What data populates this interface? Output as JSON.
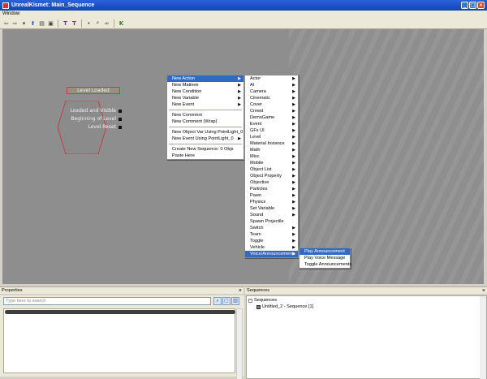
{
  "window": {
    "title": "UnrealKismet: Main_Sequence",
    "buttons": [
      "_",
      "□",
      "×"
    ]
  },
  "menubar": {
    "items": [
      "Window"
    ]
  },
  "toolbar": {
    "icons": [
      "back-icon",
      "forward-icon",
      "dropdown-icon",
      "open-parent-icon",
      "search-icon",
      "screenshot-icon",
      "rename-icon",
      "comment-icon",
      "dot-icon",
      "zoom-icon",
      "link-icon",
      "kismet-icon"
    ]
  },
  "node": {
    "title": "Level Loaded",
    "outputs": [
      "Loaded and Visible",
      "Beginning of Level",
      "Level Reset"
    ]
  },
  "context_menu": {
    "items": [
      {
        "label": "New Action",
        "arrow": "▶",
        "highlighted": true
      },
      {
        "label": "New Matinee",
        "arrow": "▶"
      },
      {
        "label": "New Condition",
        "arrow": "▶"
      },
      {
        "label": "New Variable",
        "arrow": "▶"
      },
      {
        "label": "New Event",
        "arrow": "▶"
      },
      {
        "separator": true
      },
      {
        "label": "New Comment"
      },
      {
        "label": "New Comment (Wrap)"
      },
      {
        "separator": true
      },
      {
        "label": "New Object Var Using PointLight_0"
      },
      {
        "label": "New Event Using PointLight_0",
        "arrow": "▶"
      },
      {
        "separator": true
      },
      {
        "label": "Create New Sequence: 0 Objs"
      },
      {
        "label": "Paste Here"
      }
    ]
  },
  "action_submenu": {
    "items": [
      "Actor",
      "AI",
      "Camera",
      "Cinematic",
      "Cover",
      "Crowd",
      "DemoGame",
      "Event",
      "GFx UI",
      "Level",
      "Material Instance",
      "Math",
      "Misc",
      "Mobile",
      "Object List",
      "Object Property",
      "Objective",
      "Particles",
      "Pawn",
      "Physics",
      "Set Variable",
      "Sound",
      "Spawn Projectile",
      "Switch",
      "Team",
      "Toggle",
      "Vehicle",
      "Voice/Announcements"
    ],
    "no_arrow": [
      "Spawn Projectile"
    ],
    "highlighted": "Voice/Announcements",
    "arrow": "▶"
  },
  "voice_submenu": {
    "items": [
      "Play Announcement",
      "Play Voice Message",
      "Toggle Announcements"
    ],
    "highlighted": "Play Announcement"
  },
  "properties": {
    "title": "Properties",
    "close": "×",
    "search_placeholder": "Type here to search"
  },
  "sequences": {
    "title": "Sequences",
    "close": "×",
    "tree": [
      {
        "label": "Sequences",
        "expander": "-"
      },
      {
        "label": "Untitled_2 - Sequence [1]"
      }
    ]
  }
}
